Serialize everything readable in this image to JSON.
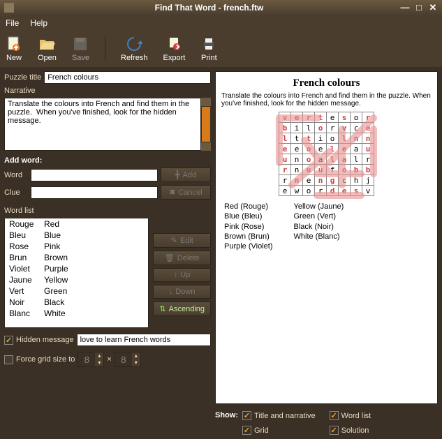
{
  "window_title": "Find That Word - french.ftw",
  "menu": {
    "file": "File",
    "help": "Help"
  },
  "toolbar": {
    "new": "New",
    "open": "Open",
    "save": "Save",
    "refresh": "Refresh",
    "export": "Export",
    "print": "Print"
  },
  "labels": {
    "puzzle_title": "Puzzle title",
    "narrative": "Narrative",
    "add_word": "Add word:",
    "word": "Word",
    "clue": "Clue",
    "add": "Add",
    "cancel": "Cancel",
    "word_list": "Word list",
    "edit": "Edit",
    "delete": "Delete",
    "up": "Up",
    "down": "Down",
    "ascending": "Ascending",
    "hidden_message": "Hidden message",
    "force_grid_size": "Force grid size to",
    "times": "×",
    "show": "Show:",
    "title_narrative": "Title and narrative",
    "show_wordlist": "Word list",
    "grid": "Grid",
    "solution": "Solution"
  },
  "fields": {
    "puzzle_title": "French colours",
    "narrative": "Translate the colours into French and find them in the puzzle.  When you've finished, look for the hidden message.",
    "word": "",
    "clue": "",
    "hidden_message": "love to learn French words",
    "grid_w": "8",
    "grid_h": "8"
  },
  "checks": {
    "hidden_message": true,
    "force_grid": false,
    "title_narrative": true,
    "wordlist": true,
    "grid": true,
    "solution": true
  },
  "wordlist": [
    {
      "w": "Rouge",
      "c": "Red"
    },
    {
      "w": "Bleu",
      "c": "Blue"
    },
    {
      "w": "Rose",
      "c": "Pink"
    },
    {
      "w": "Brun",
      "c": "Brown"
    },
    {
      "w": "Violet",
      "c": "Purple"
    },
    {
      "w": "Jaune",
      "c": "Yellow"
    },
    {
      "w": "Vert",
      "c": "Green"
    },
    {
      "w": "Noir",
      "c": "Black"
    },
    {
      "w": "Blanc",
      "c": "White"
    }
  ],
  "preview": {
    "title": "French colours",
    "narrative": "Translate the colours into French and find them in the puzzle.  When you've finished, look for the hidden message.",
    "grid": [
      [
        "v",
        "e",
        "r",
        "t",
        "e",
        "s",
        "o",
        "r"
      ],
      [
        "b",
        "i",
        "l",
        "o",
        "r",
        "v",
        "c",
        "e"
      ],
      [
        "l",
        "t",
        "t",
        "i",
        "o",
        "l",
        "n",
        "n"
      ],
      [
        "e",
        "e",
        "o",
        "e",
        "l",
        "e",
        "a",
        "u"
      ],
      [
        "u",
        "n",
        "o",
        "a",
        "l",
        "a",
        "l",
        "r"
      ],
      [
        "r",
        "n",
        "u",
        "u",
        "f",
        "o",
        "b",
        "b"
      ],
      [
        "r",
        "n",
        "e",
        "n",
        "g",
        "c",
        "h",
        "j"
      ],
      [
        "e",
        "w",
        "o",
        "r",
        "d",
        "e",
        "s",
        "v"
      ]
    ],
    "highlights": [
      [
        0,
        0
      ],
      [
        0,
        1
      ],
      [
        0,
        2
      ],
      [
        0,
        3
      ],
      [
        0,
        5
      ],
      [
        0,
        7
      ],
      [
        1,
        0
      ],
      [
        1,
        3
      ],
      [
        1,
        7
      ],
      [
        2,
        0
      ],
      [
        2,
        2
      ],
      [
        2,
        5
      ],
      [
        2,
        7
      ],
      [
        3,
        0
      ],
      [
        3,
        2
      ],
      [
        3,
        4
      ],
      [
        3,
        5
      ],
      [
        3,
        7
      ],
      [
        4,
        0
      ],
      [
        4,
        2
      ],
      [
        4,
        4
      ],
      [
        4,
        5
      ],
      [
        5,
        0
      ],
      [
        5,
        2
      ],
      [
        5,
        3
      ],
      [
        5,
        5
      ],
      [
        5,
        6
      ],
      [
        5,
        7
      ],
      [
        6,
        1
      ],
      [
        6,
        3
      ],
      [
        6,
        4
      ],
      [
        7,
        4
      ],
      [
        7,
        5
      ],
      [
        7,
        6
      ]
    ],
    "clues_left": [
      "Red (Rouge)",
      "Blue (Bleu)",
      "Pink (Rose)",
      "Brown (Brun)",
      "Purple (Violet)"
    ],
    "clues_right": [
      "Yellow (Jaune)",
      "Green (Vert)",
      "Black (Noir)",
      "White (Blanc)"
    ]
  }
}
